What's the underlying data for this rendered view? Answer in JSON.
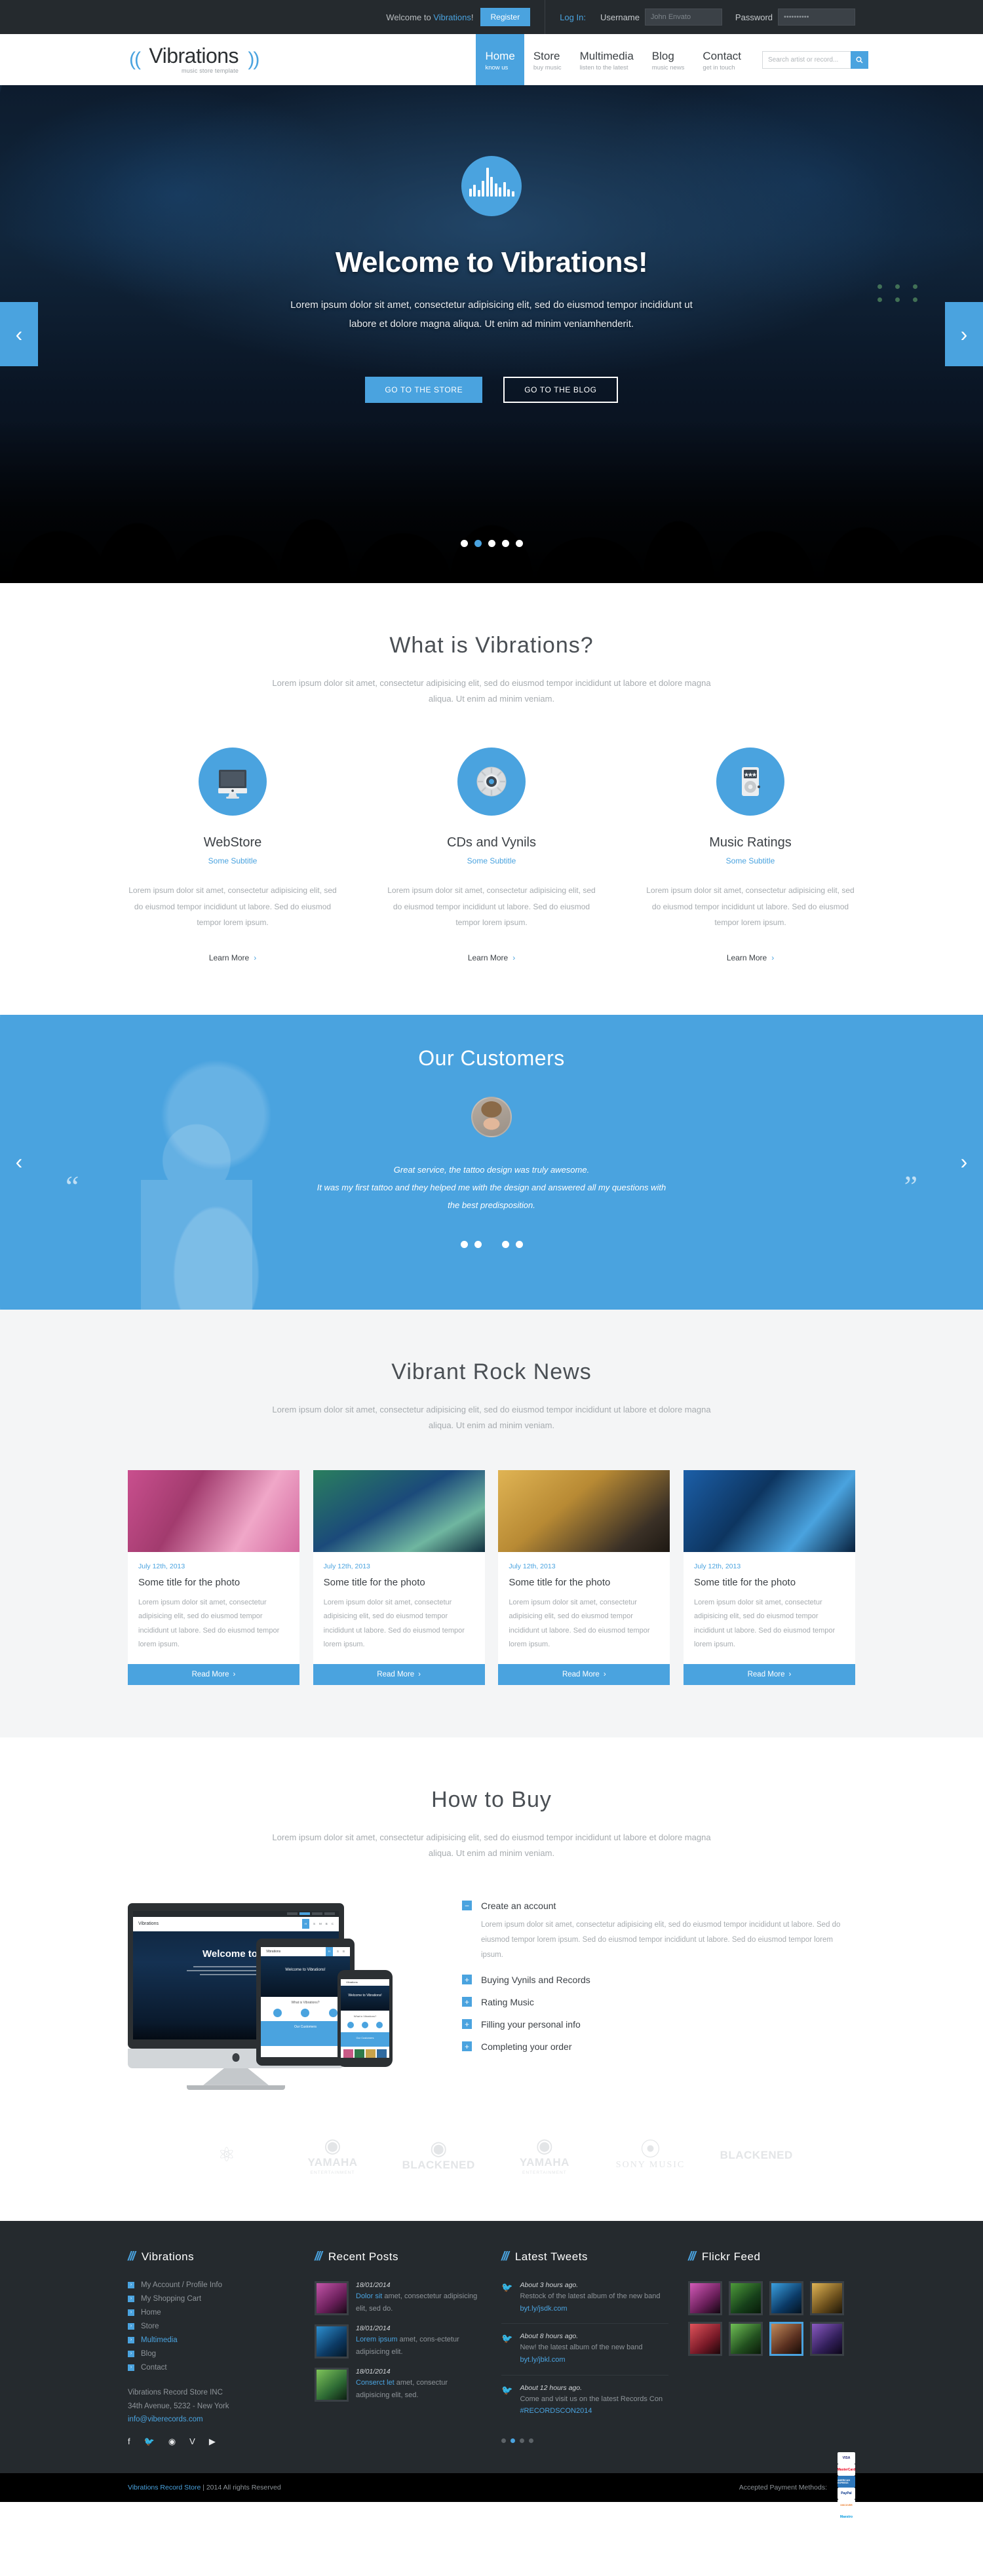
{
  "topbar": {
    "welcome_prefix": "Welcome to ",
    "welcome_brand": "Vibrations",
    "welcome_suffix": "!",
    "register_label": "Register",
    "login_label": "Log In:",
    "username_label": "Username",
    "username_placeholder": "John Envato",
    "password_label": "Password",
    "password_value": "••••••••••"
  },
  "header": {
    "logo_name": "Vibrations",
    "logo_sub": "music store template",
    "nav": [
      {
        "label": "Home",
        "sub": "know us",
        "active": true
      },
      {
        "label": "Store",
        "sub": "buy music",
        "active": false
      },
      {
        "label": "Multimedia",
        "sub": "listen to the latest",
        "active": false
      },
      {
        "label": "Blog",
        "sub": "music news",
        "active": false
      },
      {
        "label": "Contact",
        "sub": "get in touch",
        "active": false
      }
    ],
    "search_placeholder": "Search artist or record...",
    "search_value": ""
  },
  "hero": {
    "title": "Welcome to Vibrations!",
    "subtitle": "Lorem ipsum dolor sit amet, consectetur adipisicing elit, sed do eiusmod tempor incididunt ut labore et dolore magna aliqua. Ut enim ad minim veniamhenderit.",
    "btn_store": "GO TO THE STORE",
    "btn_blog": "GO TO THE BLOG",
    "prev": "‹",
    "next": "›",
    "slides": 5,
    "active_slide": 1
  },
  "about": {
    "title": "What is Vibrations?",
    "desc": "Lorem ipsum dolor sit amet, consectetur adipisicing elit, sed do eiusmod tempor incididunt ut labore et dolore magna aliqua. Ut enim ad minim veniam.",
    "features": [
      {
        "icon": "monitor-icon",
        "title": "WebStore",
        "subtitle": "Some Subtitle",
        "text": "Lorem ipsum dolor sit amet, consectetur adipisicing elit, sed do eiusmod tempor incididunt ut labore. Sed do eiusmod tempor lorem ipsum.",
        "more": "Learn More"
      },
      {
        "icon": "cd-icon",
        "title": "CDs and Vynils",
        "subtitle": "Some Subtitle",
        "text": "Lorem ipsum dolor sit amet, consectetur adipisicing elit, sed do eiusmod tempor incididunt ut labore. Sed do eiusmod tempor lorem ipsum.",
        "more": "Learn More"
      },
      {
        "icon": "mp3-player-icon",
        "title": "Music Ratings",
        "subtitle": "Some Subtitle",
        "text": "Lorem ipsum dolor sit amet, consectetur adipisicing elit, sed do eiusmod tempor incididunt ut labore. Sed do eiusmod tempor lorem ipsum.",
        "more": "Learn More"
      }
    ]
  },
  "customers": {
    "title": "Our Customers",
    "quote_line1": "Great service, the tattoo design was truly awesome.",
    "quote_line2": "It was my first tattoo and they helped me with the design and answered all my questions with",
    "quote_line3": "the best predisposition.",
    "prev": "‹",
    "next": "›",
    "slides": 5,
    "active_slide": 2
  },
  "news": {
    "title": "Vibrant Rock News",
    "desc": "Lorem ipsum dolor sit amet, consectetur adipisicing elit, sed do eiusmod tempor incididunt ut labore et dolore magna aliqua. Ut enim ad minim veniam.",
    "cards": [
      {
        "date": "July 12th, 2013",
        "title": "Some title for the photo",
        "text": "Lorem ipsum dolor sit amet, consectetur adipisicing elit, sed do eiusmod tempor incididunt ut labore. Sed do eiusmod tempor lorem ipsum.",
        "more": "Read More",
        "img": "rock-duo-photo"
      },
      {
        "date": "July 12th, 2013",
        "title": "Some title for the photo",
        "text": "Lorem ipsum dolor sit amet, consectetur adipisicing elit, sed do eiusmod tempor incididunt ut labore. Sed do eiusmod tempor lorem ipsum.",
        "more": "Read More",
        "img": "concert-stage-photo"
      },
      {
        "date": "July 12th, 2013",
        "title": "Some title for the photo",
        "text": "Lorem ipsum dolor sit amet, consectetur adipisicing elit, sed do eiusmod tempor incididunt ut labore. Sed do eiusmod tempor lorem ipsum.",
        "more": "Read More",
        "img": "guitarist-photo"
      },
      {
        "date": "July 12th, 2013",
        "title": "Some title for the photo",
        "text": "Lorem ipsum dolor sit amet, consectetur adipisicing elit, sed do eiusmod tempor incididunt ut labore. Sed do eiusmod tempor lorem ipsum.",
        "more": "Read More",
        "img": "blue-stage-photo"
      }
    ]
  },
  "howto": {
    "title": "How to Buy",
    "desc": "Lorem ipsum dolor sit amet, consectetur adipisicing elit, sed do eiusmod tempor incididunt ut labore et dolore magna aliqua. Ut enim ad minim veniam.",
    "device_title": "Welcome to Vi",
    "tablet_title": "Welcome to Vibrations!",
    "phone_title": "Welcome to Vibrations!",
    "steps": [
      {
        "label": "Create an account",
        "open": true,
        "sign": "−",
        "body": "Lorem ipsum dolor sit amet, consectetur adipisicing elit, sed do eiusmod tempor incididunt ut labore. Sed do eiusmod tempor lorem ipsum. Sed do eiusmod tempor incididunt ut labore. Sed do eiusmod tempor lorem ipsum."
      },
      {
        "label": "Buying Vynils and Records",
        "open": false,
        "sign": "+",
        "body": ""
      },
      {
        "label": "Rating Music",
        "open": false,
        "sign": "+",
        "body": ""
      },
      {
        "label": "Filling your personal info",
        "open": false,
        "sign": "+",
        "body": ""
      },
      {
        "label": "Completing your order",
        "open": false,
        "sign": "+",
        "body": ""
      }
    ]
  },
  "brands": [
    {
      "name": "",
      "sub": "",
      "mark": "barrel-logo"
    },
    {
      "name": "YAMAHA",
      "sub": "ENTERTAINMENT",
      "mark": "yamaha-tuning-fork"
    },
    {
      "name": "BLACKENED",
      "sub": "",
      "mark": "blackened-b"
    },
    {
      "name": "YAMAHA",
      "sub": "ENTERTAINMENT",
      "mark": "yamaha-tuning-fork"
    },
    {
      "name": "SONY MUSIC",
      "sub": "",
      "mark": "sony-swoosh"
    },
    {
      "name": "BLACKENED",
      "sub": "",
      "mark": ""
    }
  ],
  "footer": {
    "col_vibrations": {
      "title": "Vibrations",
      "links": [
        {
          "label": "My Account / Profile Info",
          "hot": false
        },
        {
          "label": "My Shopping Cart",
          "hot": false
        },
        {
          "label": "Home",
          "hot": false
        },
        {
          "label": "Store",
          "hot": false
        },
        {
          "label": "Multimedia",
          "hot": true
        },
        {
          "label": "Blog",
          "hot": false
        },
        {
          "label": "Contact",
          "hot": false
        }
      ],
      "address_line1": "Vibrations Record Store INC",
      "address_line2": "34th Avenue, 5232 - New York",
      "email": "info@viberecords.com",
      "social": [
        "facebook-icon",
        "twitter-icon",
        "rss-icon",
        "vimeo-icon",
        "youtube-icon"
      ]
    },
    "col_recent": {
      "title": "Recent Posts",
      "posts": [
        {
          "date": "18/01/2014",
          "link": "Dolor sit",
          "text": " amet, consectetur adipisicing elit, sed do.",
          "img": "pink-crowd-photo"
        },
        {
          "date": "18/01/2014",
          "link": "Lorem ipsum",
          "text": " amet, cons-ectetur adipisicing elit.",
          "img": "blue-drummer-photo"
        },
        {
          "date": "18/01/2014",
          "link": "Conserct let",
          "text": " amet, consectur adipisicing elit, sed.",
          "img": "green-stage-photo"
        }
      ]
    },
    "col_tweets": {
      "title": "Latest Tweets",
      "tweets": [
        {
          "date": "About 3 hours ago.",
          "text": "Restock of the latest album of the new band ",
          "link": "byt.ly/jsdk.com"
        },
        {
          "date": "About 8 hours ago.",
          "text": "New! the latest album of the new band ",
          "link": "byt.ly/jbkl.com"
        },
        {
          "date": "About 12 hours ago.",
          "text": "Come and visit us on the latest Records Con ",
          "link": "#RECORDSCON2014"
        }
      ],
      "dots": 4,
      "active_dot": 1
    },
    "col_flickr": {
      "title": "Flickr Feed",
      "images": [
        {
          "name": "pink-crowd-thumb",
          "selected": false
        },
        {
          "name": "green-singer-thumb",
          "selected": false
        },
        {
          "name": "blue-drums-thumb",
          "selected": false
        },
        {
          "name": "guitar-bullseye-thumb",
          "selected": false
        },
        {
          "name": "red-singer-thumb",
          "selected": false
        },
        {
          "name": "green-horns-thumb",
          "selected": false
        },
        {
          "name": "dancers-thumb",
          "selected": true
        },
        {
          "name": "mic-singer-thumb",
          "selected": false
        }
      ]
    }
  },
  "bottombar": {
    "brand": "Vibrations Record Store",
    "copyright": " | 2014 All rights Reserved",
    "payment_label": "Accepted Payment Methods:",
    "methods": [
      "VISA",
      "MasterCard",
      "AMERICAN EXPRESS",
      "PayPal",
      "DISCOVER",
      "Maestro"
    ]
  },
  "colors": {
    "accent": "#4aa3df",
    "dark": "#252a2e",
    "black": "#000000",
    "muted": "#a6abaf"
  }
}
